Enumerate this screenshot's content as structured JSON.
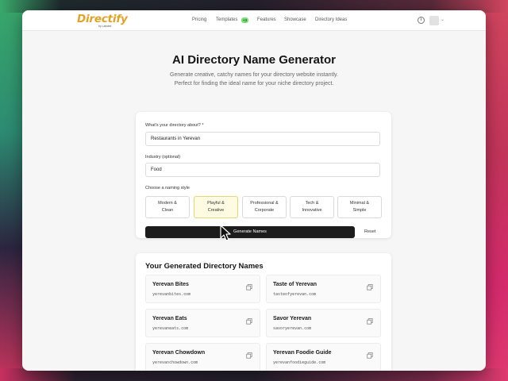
{
  "nav": {
    "logo": "Directify",
    "logo_sub": "by Landed",
    "links": [
      "Pricing",
      "Templates",
      "Features",
      "Showcase",
      "Directory Ideas"
    ],
    "templates_badge": "+3"
  },
  "hero": {
    "title": "AI Directory Name Generator",
    "subtitle_line1": "Generate creative, catchy names for your directory website instantly.",
    "subtitle_line2": "Perfect for finding the ideal name for your niche directory project."
  },
  "form": {
    "about_label": "What's your directory about? *",
    "about_value": "Restaurants in Yerevan",
    "industry_label": "Industry (optional)",
    "industry_value": "Food",
    "style_label": "Choose a naming style",
    "styles": [
      {
        "line1": "Modern &",
        "line2": "Clean"
      },
      {
        "line1": "Playful &",
        "line2": "Creative"
      },
      {
        "line1": "Professional &",
        "line2": "Corporate"
      },
      {
        "line1": "Tech &",
        "line2": "Innovative"
      },
      {
        "line1": "Minimal &",
        "line2": "Simple"
      }
    ],
    "selected_style_index": 1,
    "generate_label": "Generate Names",
    "reset_label": "Reset"
  },
  "results": {
    "title": "Your Generated Directory Names",
    "names": [
      {
        "name": "Yerevan Bites",
        "domain": "yerevanbites.com"
      },
      {
        "name": "Taste of Yerevan",
        "domain": "tasteofyerevan.com"
      },
      {
        "name": "Yerevan Eats",
        "domain": "yerevaneats.com"
      },
      {
        "name": "Savor Yerevan",
        "domain": "savoryerevan.com"
      },
      {
        "name": "Yerevan Chowdown",
        "domain": "yerevanchowdown.com"
      },
      {
        "name": "Yerevan Foodie Guide",
        "domain": "yerevanfoodieguide.com"
      }
    ]
  },
  "colors": {
    "brand": "#e0a325",
    "selected_bg": "#fdfbe2",
    "primary_button": "#1c1c1c"
  },
  "icons": {
    "copy": "copy-icon",
    "info": "info-icon",
    "cursor": "mouse-pointer-icon"
  }
}
